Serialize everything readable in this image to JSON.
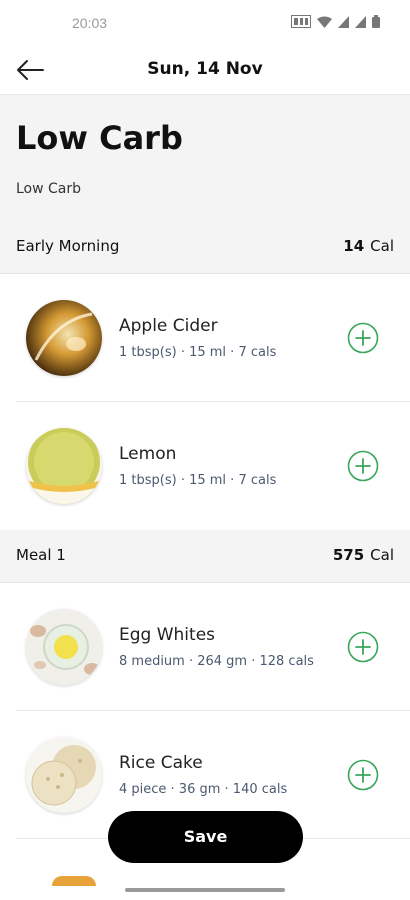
{
  "status_bar": {
    "time": "20:03",
    "icons": [
      "nfc-icon",
      "wifi-icon",
      "signal-icon",
      "signal-icon",
      "battery-icon"
    ]
  },
  "app_bar": {
    "back_icon": "arrow-left-icon",
    "date": "Sun, 14 Nov"
  },
  "plan": {
    "title": "Low Carb",
    "subtitle": "Low Carb"
  },
  "sections": [
    {
      "name": "Early Morning",
      "calories": "14",
      "unit": "Cal",
      "items": [
        {
          "name": "Apple Cider",
          "detail": "1 tbsp(s) · 15 ml · 7 cals"
        },
        {
          "name": "Lemon",
          "detail": "1 tbsp(s) · 15 ml · 7 cals"
        }
      ]
    },
    {
      "name": "Meal 1",
      "calories": "575",
      "unit": "Cal",
      "items": [
        {
          "name": "Egg Whites",
          "detail": "8 medium · 264 gm · 128 cals"
        },
        {
          "name": "Rice Cake",
          "detail": "4 piece · 36 gm · 140 cals"
        }
      ]
    }
  ],
  "save_label": "Save",
  "colors": {
    "accent_green": "#3aa65a",
    "button_black": "#000000",
    "section_bg": "#f4f4f4"
  }
}
